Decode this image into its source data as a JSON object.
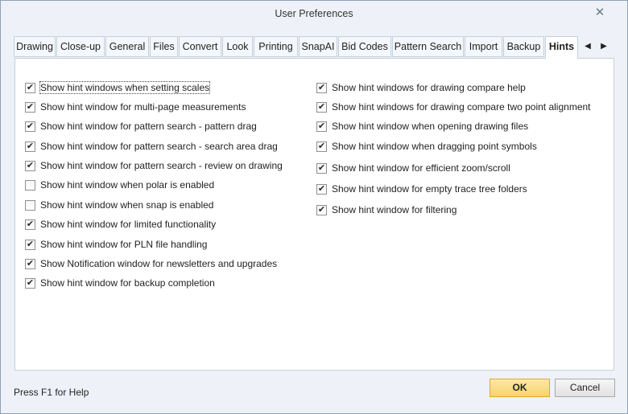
{
  "window": {
    "title": "User Preferences"
  },
  "tabs": [
    {
      "label": "Drawing"
    },
    {
      "label": "Close-up"
    },
    {
      "label": "General"
    },
    {
      "label": "Files"
    },
    {
      "label": "Convert"
    },
    {
      "label": "Look"
    },
    {
      "label": "Printing"
    },
    {
      "label": "SnapAI"
    },
    {
      "label": "Bid Codes"
    },
    {
      "label": "Pattern Search"
    },
    {
      "label": "Import"
    },
    {
      "label": "Backup"
    },
    {
      "label": "Hints"
    }
  ],
  "active_tab": "Hints",
  "tab_scroll": {
    "left_glyph": "◀",
    "right_glyph": "▶"
  },
  "check_glyph": "✔",
  "options_left": [
    {
      "label": "Show hint windows when setting scales",
      "checked": true
    },
    {
      "label": "Show hint window for multi-page measurements",
      "checked": true
    },
    {
      "label": "Show hint window for pattern search - pattern drag",
      "checked": true
    },
    {
      "label": "Show hint window for pattern search - search area drag",
      "checked": true
    },
    {
      "label": "Show hint window for pattern search - review on drawing",
      "checked": true
    },
    {
      "label": "Show hint window when polar is enabled",
      "checked": false
    },
    {
      "label": "Show hint window when snap is enabled",
      "checked": false
    },
    {
      "label": "Show hint window for limited functionality",
      "checked": true
    },
    {
      "label": "Show hint window for PLN file handling",
      "checked": true
    },
    {
      "label": "Show Notification window for newsletters and upgrades",
      "checked": true
    },
    {
      "label": "Show hint window for backup completion",
      "checked": true
    }
  ],
  "options_right": [
    {
      "label": "Show hint windows for drawing compare help",
      "checked": true
    },
    {
      "label": "Show hint windows for drawing compare two point alignment",
      "checked": true
    },
    {
      "label": "Show hint window when opening drawing files",
      "checked": true
    },
    {
      "label": "Show hint window when dragging point symbols",
      "checked": true
    },
    {
      "label": "Show hint window for efficient zoom/scroll",
      "checked": true
    },
    {
      "label": "Show hint window for empty trace tree folders",
      "checked": true
    },
    {
      "label": "Show hint window for filtering",
      "checked": true
    }
  ],
  "footer": {
    "help_text": "Press F1 for Help",
    "ok_label": "OK",
    "cancel_label": "Cancel"
  },
  "colors": {
    "ok_button": "#f7d36a",
    "window_bg": "#eef2f8",
    "panel_bg": "#ffffff"
  }
}
